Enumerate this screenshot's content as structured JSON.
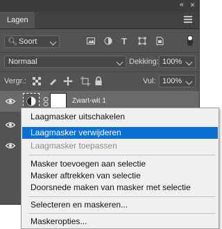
{
  "panel": {
    "tab_label": "Lagen",
    "collapse_glyph": "«",
    "close_glyph": "×"
  },
  "filter": {
    "kind_value": "Soort",
    "icons": [
      "image-filter-icon",
      "adjustment-filter-icon",
      "type-filter-icon",
      "shape-filter-icon",
      "smart-object-filter-icon"
    ]
  },
  "blend": {
    "mode_value": "Normaal",
    "opacity_label": "Dekking:",
    "opacity_value": "100%"
  },
  "lock": {
    "label": "Vergr.:",
    "fill_label": "Vul:",
    "fill_value": "100%"
  },
  "layer": {
    "name": "Zwart-wit 1"
  },
  "context_menu": {
    "items": [
      {
        "label": "Laagmasker uitschakelen",
        "state": "normal"
      },
      {
        "label": "Laagmasker verwijderen",
        "state": "highlighted"
      },
      {
        "label": "Laagmasker toepassen",
        "state": "disabled"
      },
      {
        "label": "Masker toevoegen aan selectie",
        "state": "normal"
      },
      {
        "label": "Masker aftrekken van selectie",
        "state": "normal"
      },
      {
        "label": "Doorsnede maken van masker met selectie",
        "state": "normal"
      },
      {
        "label": "Selecteren en maskeren...",
        "state": "normal"
      },
      {
        "label": "Maskeropties...",
        "state": "normal"
      }
    ],
    "highlight_color": "#0a6fd2"
  }
}
